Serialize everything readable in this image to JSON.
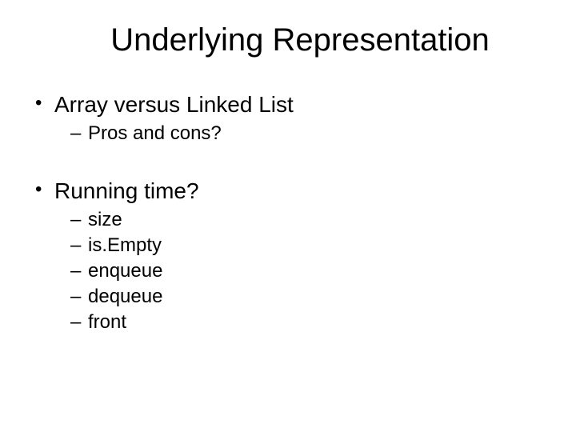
{
  "title": "Underlying Representation",
  "points": [
    {
      "text": "Array versus Linked List",
      "sub": [
        "Pros and cons?"
      ]
    },
    {
      "text": "Running time?",
      "sub": [
        "size",
        "is.Empty",
        "enqueue",
        "dequeue",
        "front"
      ]
    }
  ]
}
